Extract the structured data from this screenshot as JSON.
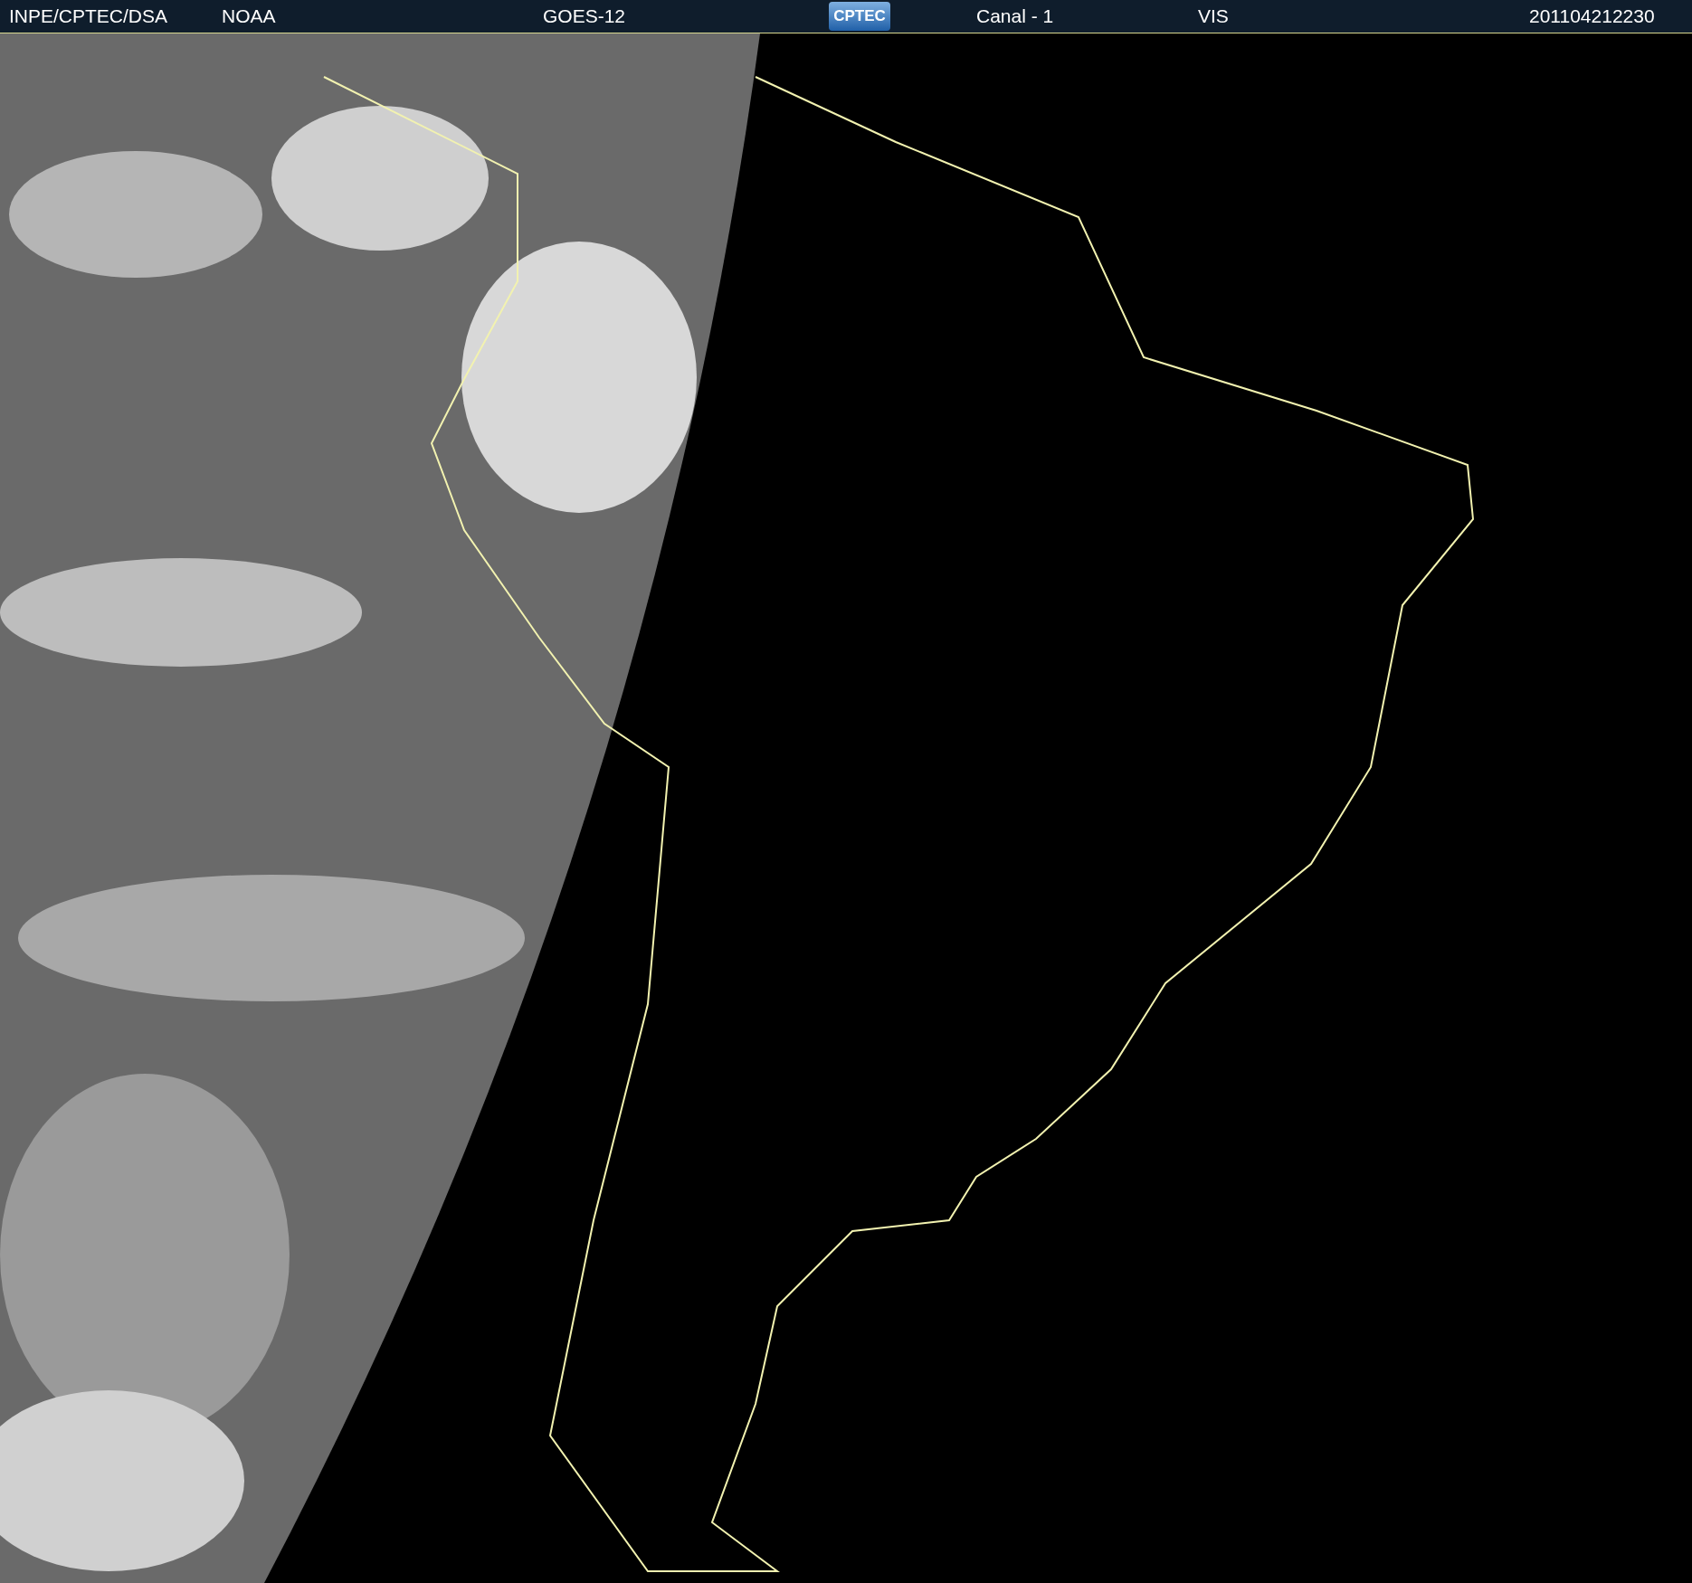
{
  "header": {
    "source": "INPE/CPTEC/DSA",
    "agency": "NOAA",
    "satellite": "GOES-12",
    "logo": "CPTEC",
    "channel": "Canal - 1",
    "band": "VIS",
    "timestamp": "201104212230"
  }
}
